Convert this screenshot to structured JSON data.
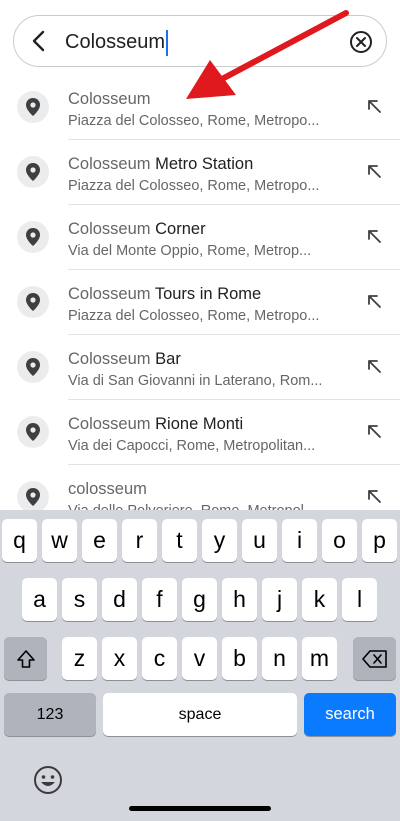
{
  "search": {
    "value": "Colosseum"
  },
  "results": [
    {
      "match": "Colosseum",
      "rest": "",
      "subtitle": "Piazza del Colosseo, Rome, Metropo..."
    },
    {
      "match": "Colosseum",
      "rest": " Metro Station",
      "subtitle": "Piazza del Colosseo, Rome, Metropo..."
    },
    {
      "match": "Colosseum",
      "rest": " Corner",
      "subtitle": "Via del Monte Oppio, Rome, Metrop..."
    },
    {
      "match": "Colosseum",
      "rest": " Tours in Rome",
      "subtitle": "Piazza del Colosseo, Rome, Metropo..."
    },
    {
      "match": "Colosseum",
      "rest": " Bar",
      "subtitle": "Via di San Giovanni in Laterano, Rom..."
    },
    {
      "match": "Colosseum",
      "rest": " Rione Monti",
      "subtitle": "Via dei Capocci, Rome, Metropolitan..."
    },
    {
      "match": "colosseum",
      "rest": "",
      "subtitle": "Via delle Polveriere, Rome, Metropol..."
    }
  ],
  "keyboard": {
    "row1": [
      "q",
      "w",
      "e",
      "r",
      "t",
      "y",
      "u",
      "i",
      "o",
      "p"
    ],
    "row2": [
      "a",
      "s",
      "d",
      "f",
      "g",
      "h",
      "j",
      "k",
      "l"
    ],
    "row3": [
      "z",
      "x",
      "c",
      "v",
      "b",
      "n",
      "m"
    ],
    "numbers_label": "123",
    "space_label": "space",
    "search_label": "search"
  },
  "colors": {
    "annotation_arrow": "#e0191e",
    "search_key": "#0a7aff",
    "caret": "#1a73e8"
  }
}
